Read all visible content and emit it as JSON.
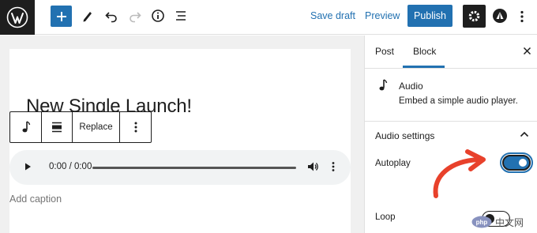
{
  "toolbar": {
    "logo": "wordpress-logo",
    "save_draft_label": "Save draft",
    "preview_label": "Preview",
    "publish_label": "Publish"
  },
  "editor": {
    "title": "New Single Launch!",
    "block_toolbar": {
      "replace_label": "Replace"
    },
    "audio": {
      "time": "0:00 / 0:00",
      "progress": 0
    },
    "caption_placeholder": "Add caption"
  },
  "sidebar": {
    "tabs": [
      {
        "label": "Post",
        "active": false
      },
      {
        "label": "Block",
        "active": true
      }
    ],
    "block_card": {
      "title": "Audio",
      "description": "Embed a simple audio player."
    },
    "panel": {
      "title": "Audio settings",
      "autoplay_label": "Autoplay",
      "autoplay_on": true,
      "loop_label": "Loop",
      "loop_on": false
    }
  },
  "watermark": {
    "text": "中文网"
  },
  "colors": {
    "accent": "#2271b1",
    "dark": "#1e1e1e",
    "annotation": "#e8412b"
  }
}
